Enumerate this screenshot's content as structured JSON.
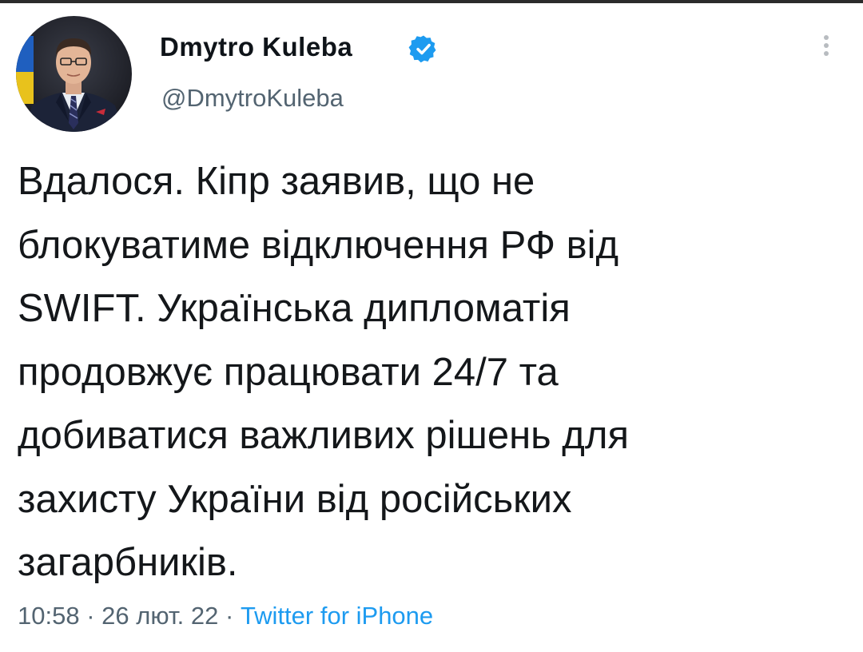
{
  "author": {
    "display_name": "Dmytro Kuleba",
    "handle": "@DmytroKuleba",
    "verified_icon": "verified-badge",
    "avatar_icon": "profile-photo"
  },
  "tweet": {
    "lines": [
      "Вдалося. Кіпр заявив, що не",
      "блокуватиме відключення РФ від",
      "SWIFT. Українська дипломатія",
      "продовжує працювати 24/7 та",
      "добиватися важливих рішень для",
      "захисту України від російських",
      "загарбників."
    ]
  },
  "meta": {
    "time": "10:58",
    "separator": " · ",
    "date": "26 лют. 22",
    "source": "Twitter for iPhone"
  },
  "colors": {
    "accent": "#1d9bf0",
    "text": "#0f1419",
    "secondary": "#536471"
  },
  "menu": {
    "icon": "more-vertical-icon"
  }
}
